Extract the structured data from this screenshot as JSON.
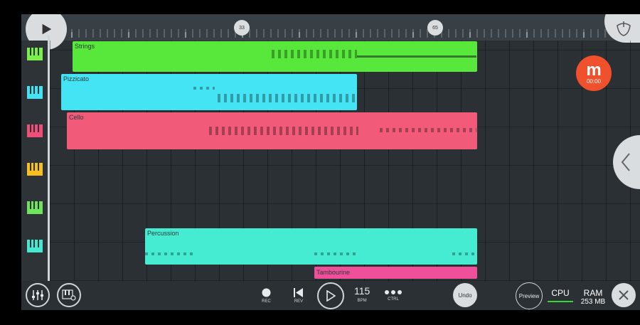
{
  "ruler": {
    "markers": [
      "33",
      "65"
    ]
  },
  "tracks": [
    {
      "icon": "piano-green-icon",
      "color": "#7cf04a"
    },
    {
      "icon": "piano-cyan-icon",
      "color": "#42e4f3"
    },
    {
      "icon": "piano-pink-icon",
      "color": "#f04e76"
    },
    {
      "icon": "piano-yellow-icon",
      "color": "#f5c020"
    },
    {
      "icon": "piano-green-icon",
      "color": "#6fe35a"
    },
    {
      "icon": "piano-teal-icon",
      "color": "#46e8d1"
    }
  ],
  "clips": [
    {
      "name": "Strings",
      "color": "#58e83c"
    },
    {
      "name": "Pizzicato",
      "color": "#44e4f4"
    },
    {
      "name": "Cello",
      "color": "#f25a7a"
    },
    {
      "name": "Percussion",
      "color": "#46ecd2"
    },
    {
      "name": "Tambourine",
      "color": "#f0509a"
    }
  ],
  "recorder": {
    "logo": "m",
    "time": "00:00"
  },
  "bottom": {
    "rec_label": "REC",
    "rev_label": "REV",
    "bpm_value": "115",
    "bpm_label": "BPM",
    "ctrl_label": "CTRL",
    "undo_label": "Undo",
    "preview_label": "Preview",
    "cpu_label": "CPU",
    "ram_label": "RAM",
    "ram_value": "253 MB"
  }
}
